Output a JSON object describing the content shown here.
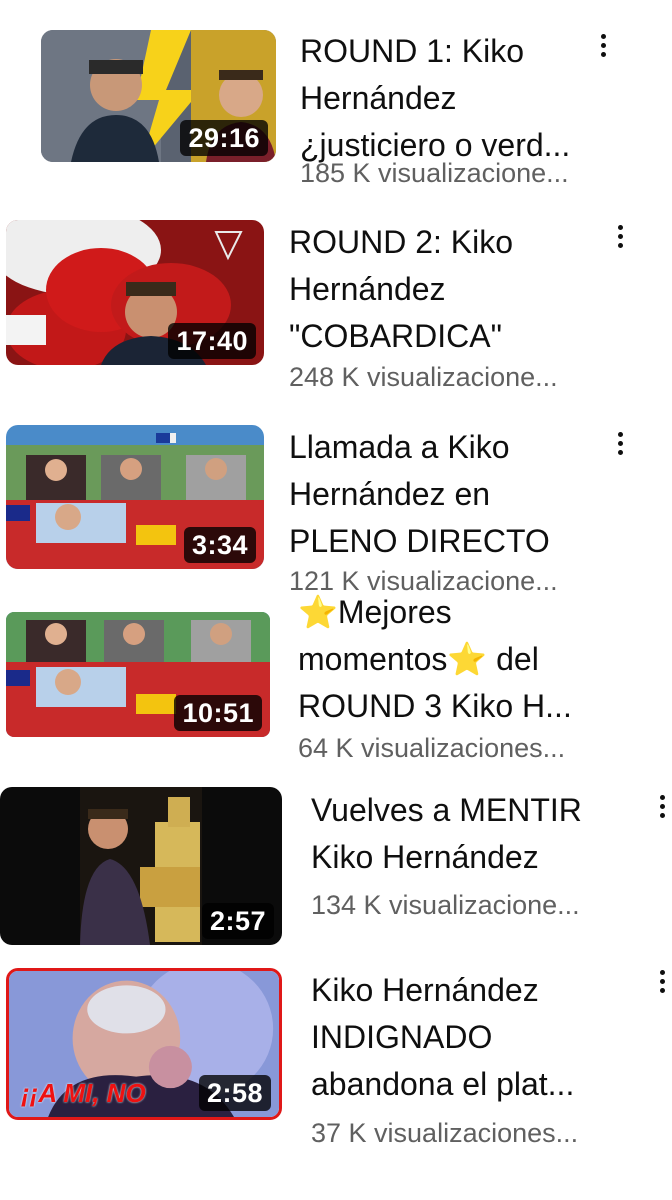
{
  "videos": [
    {
      "title_lines": [
        "ROUND 1: Kiko",
        "Hernández",
        "¿justiciero o verd..."
      ],
      "views": "185 K visualizacione...",
      "duration": "29:16"
    },
    {
      "title_lines": [
        "ROUND 2: Kiko",
        "Hernández",
        "\"COBARDICA\""
      ],
      "views": "248 K visualizacione...",
      "duration": "17:40"
    },
    {
      "title_lines": [
        "Llamada a Kiko",
        "Hernández en",
        "PLENO DIRECTO"
      ],
      "views": "121 K visualizacione...",
      "duration": "3:34"
    },
    {
      "title_lines": [
        "⭐Mejores",
        "momentos⭐ del",
        "ROUND 3 Kiko H..."
      ],
      "views": "64 K visualizaciones...",
      "duration": "10:51"
    },
    {
      "title_lines": [
        "Vuelves a MENTIR",
        "Kiko Hernández"
      ],
      "views": "134 K visualizacione...",
      "duration": "2:57"
    },
    {
      "title_lines": [
        "Kiko Hernández",
        "INDIGNADO",
        "abandona el plat..."
      ],
      "views": "37 K visualizaciones...",
      "duration": "2:58",
      "caption": "¡¡A MI, NO"
    }
  ],
  "colors": {
    "duration_bg": "#000000",
    "views_text": "#606060",
    "thumb6_border": "#e01818"
  },
  "icons": [
    "more-vert-icon"
  ]
}
